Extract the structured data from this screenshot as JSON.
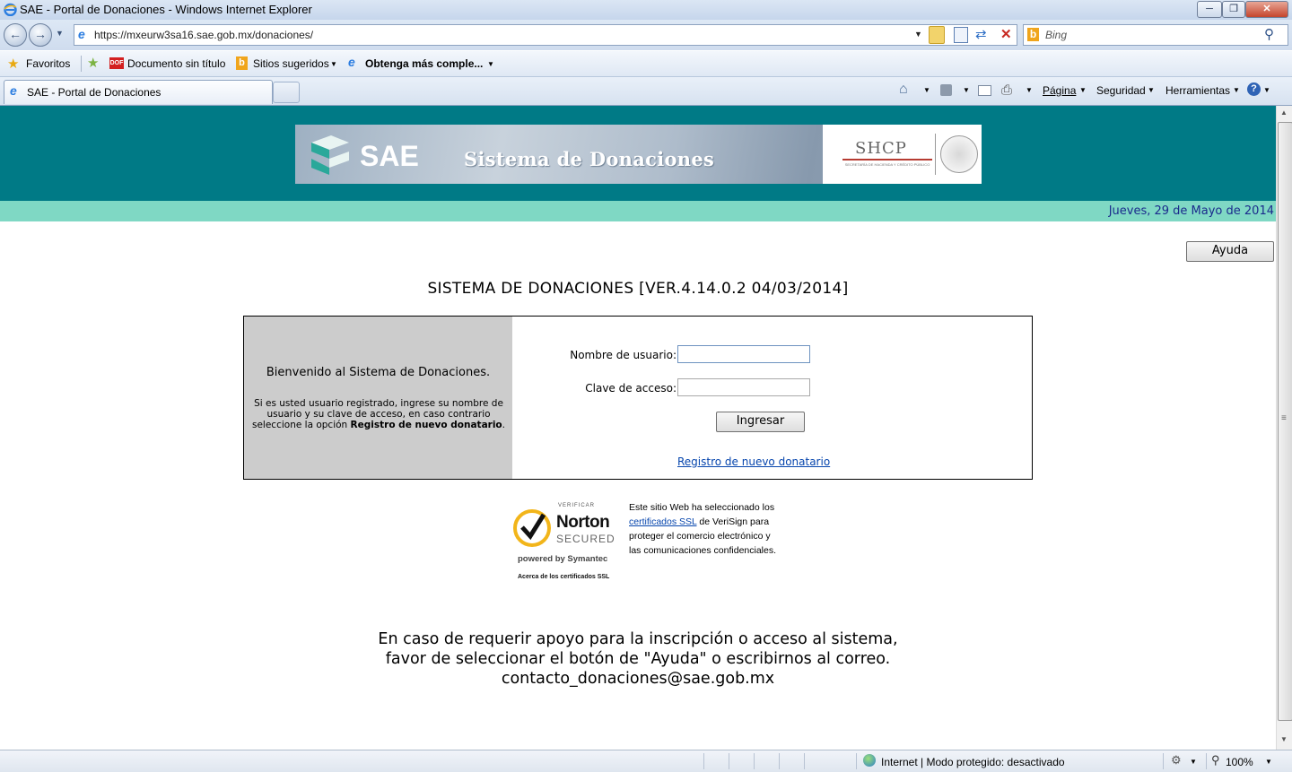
{
  "window": {
    "title": "SAE - Portal de Donaciones - Windows Internet Explorer",
    "address": "https://mxeurw3sa16.sae.gob.mx/donaciones/",
    "search_placeholder": "Bing"
  },
  "favorites": {
    "label": "Favoritos",
    "items": [
      "Documento sin título",
      "Sitios sugeridos",
      "Obtenga más comple..."
    ]
  },
  "tab": {
    "label": "SAE - Portal de Donaciones"
  },
  "commands": {
    "page": "Página",
    "security": "Seguridad",
    "tools": "Herramientas"
  },
  "banner": {
    "logo_text": "SAE",
    "title": "Sistema de Donaciones",
    "shcp": "SHCP",
    "shcp_sub": "SECRETARÍA DE HACIENDA Y CRÉDITO PÚBLICO"
  },
  "date": "Jueves, 29 de Mayo de 2014",
  "help_button": "Ayuda",
  "system_title": "SISTEMA DE DONACIONES [VER.4.14.0.2 04/03/2014]",
  "login": {
    "welcome": "Bienvenido al Sistema de Donaciones.",
    "instructions_prefix": "Si es usted usuario registrado, ingrese su nombre de usuario y su clave de acceso, en caso contrario seleccione la opción ",
    "instructions_bold": "Registro de nuevo donatario",
    "instructions_suffix": ".",
    "username_label": "Nombre de usuario:",
    "username_value": "",
    "password_label": "Clave de acceso:",
    "password_value": "",
    "submit_label": "Ingresar",
    "register_link": "Registro de nuevo donatario"
  },
  "norton": {
    "verify": "VERIFICAR",
    "brand": "Norton",
    "secured": "SECURED",
    "powered": "powered by Symantec",
    "about": "Acerca de los certificados SSL",
    "text_1": "Este sitio Web ha seleccionado los ",
    "link": "certificados SSL",
    "text_2": " de VeriSign para proteger el comercio electrónico y las comunicaciones confidenciales."
  },
  "support": {
    "line1": "En caso de requerir apoyo para la inscripción o acceso al sistema,",
    "line2": "favor de seleccionar el botón de \"Ayuda\" o escribirnos al correo.",
    "email": "contacto_donaciones@sae.gob.mx"
  },
  "status": {
    "zone": "Internet | Modo protegido: desactivado",
    "zoom": "100%"
  }
}
